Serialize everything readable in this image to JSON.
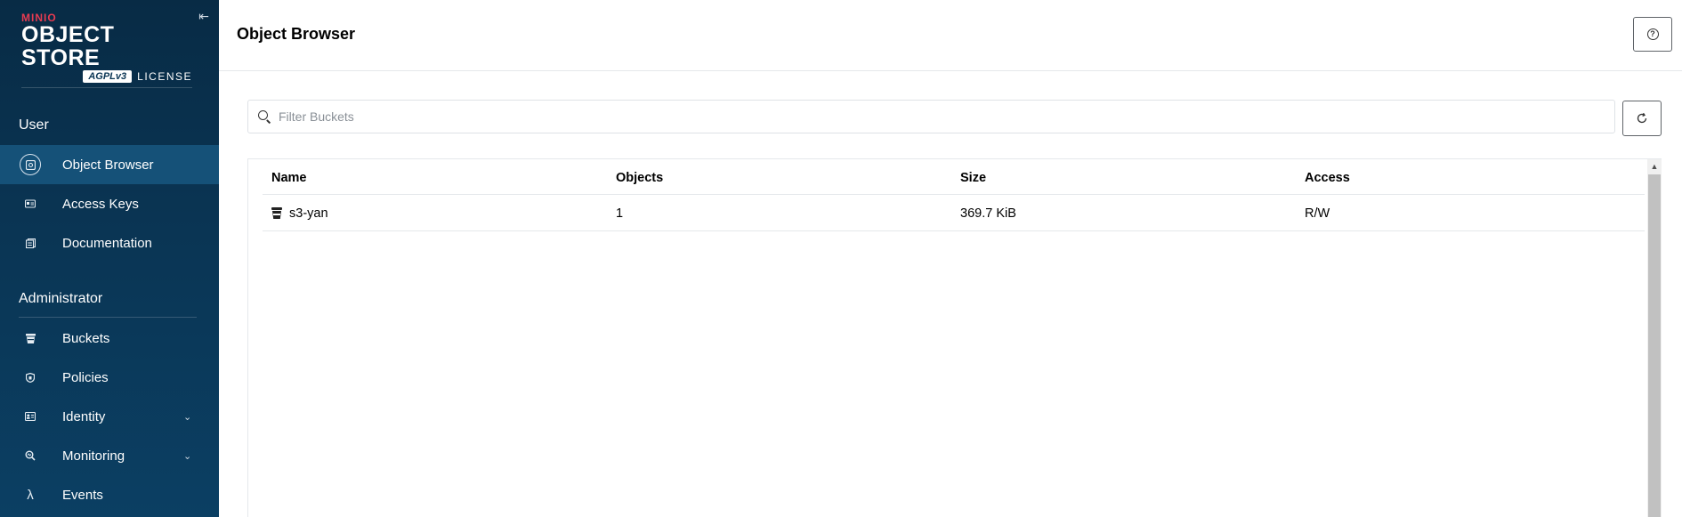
{
  "sidebar": {
    "logo": {
      "brand": "MINIO",
      "product": "OBJECT STORE",
      "license_badge": "AGPLv3",
      "license_label": "LICENSE"
    },
    "collapse_icon": "collapse-left-icon",
    "sections": {
      "user": "User",
      "admin": "Administrator"
    },
    "user_items": [
      {
        "label": "Object Browser",
        "icon": "object-browser-icon",
        "active": true
      },
      {
        "label": "Access Keys",
        "icon": "access-keys-icon"
      },
      {
        "label": "Documentation",
        "icon": "documentation-icon"
      }
    ],
    "admin_items": [
      {
        "label": "Buckets",
        "icon": "bucket-icon"
      },
      {
        "label": "Policies",
        "icon": "shield-icon"
      },
      {
        "label": "Identity",
        "icon": "identity-icon",
        "expandable": true
      },
      {
        "label": "Monitoring",
        "icon": "monitoring-icon",
        "expandable": true
      },
      {
        "label": "Events",
        "icon": "lambda-icon"
      }
    ]
  },
  "header": {
    "title": "Object Browser",
    "help_icon": "help-icon"
  },
  "filter": {
    "placeholder": "Filter Buckets",
    "value": ""
  },
  "table": {
    "columns": [
      "Name",
      "Objects",
      "Size",
      "Access"
    ],
    "rows": [
      {
        "name": "s3-yan",
        "objects": "1",
        "size": "369.7 KiB",
        "access": "R/W"
      }
    ]
  },
  "colors": {
    "sidebar_bg": "#0a3554",
    "sidebar_active": "#155178",
    "brand_red": "#e73b51"
  }
}
